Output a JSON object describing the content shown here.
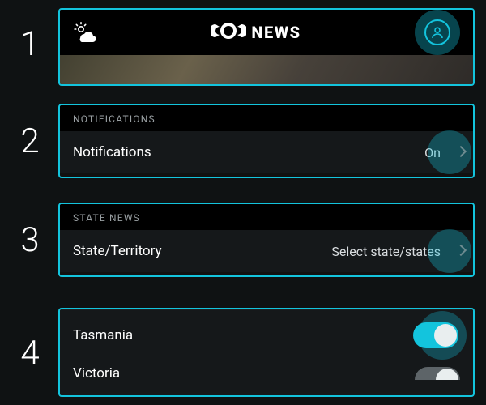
{
  "steps": [
    "1",
    "2",
    "3",
    "4"
  ],
  "header": {
    "brand_text": "NEWS"
  },
  "notifications": {
    "section": "NOTIFICATIONS",
    "label": "Notifications",
    "value": "On"
  },
  "state_news": {
    "section": "STATE NEWS",
    "label": "State/Territory",
    "value": "Select state/states"
  },
  "states": {
    "item1": {
      "label": "Tasmania",
      "on": true
    },
    "item2": {
      "label": "Victoria",
      "on": false
    }
  }
}
